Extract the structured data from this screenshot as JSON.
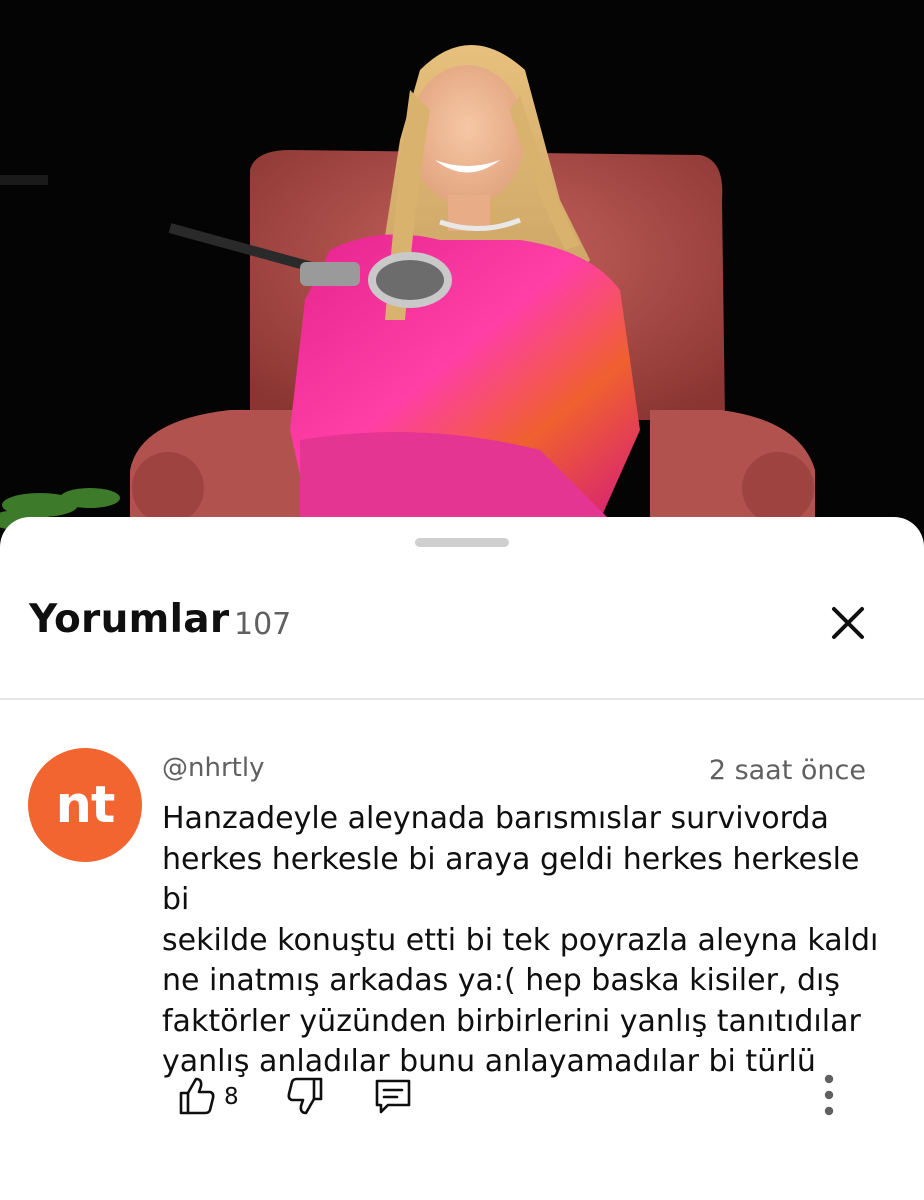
{
  "video": {
    "description_icon": "podcast-scene"
  },
  "comments_sheet": {
    "title": "Yorumlar",
    "count": "107",
    "close_icon": "close-icon"
  },
  "comment": {
    "avatar_initials": "nt",
    "avatar_color": "#f26531",
    "author": "@nhrtly",
    "time": "2 saat önce",
    "text": "Hanzadeyle aleynada barısmıslar survivorda\nherkes herkesle bi araya geldi herkes herkesle bi\nsekilde konuştu etti bi tek poyrazla aleyna kaldı\nne inatmış arkadas ya:( hep baska kisiler, dış\nfaktörler yüzünden birbirlerini yanlış tanıtıdılar\nyanlış anladılar bunu anlayamadılar bi türlü",
    "like_count": "8",
    "icons": {
      "like": "thumbs-up-icon",
      "dislike": "thumbs-down-icon",
      "reply": "reply-icon",
      "more": "more-vertical-icon"
    }
  }
}
